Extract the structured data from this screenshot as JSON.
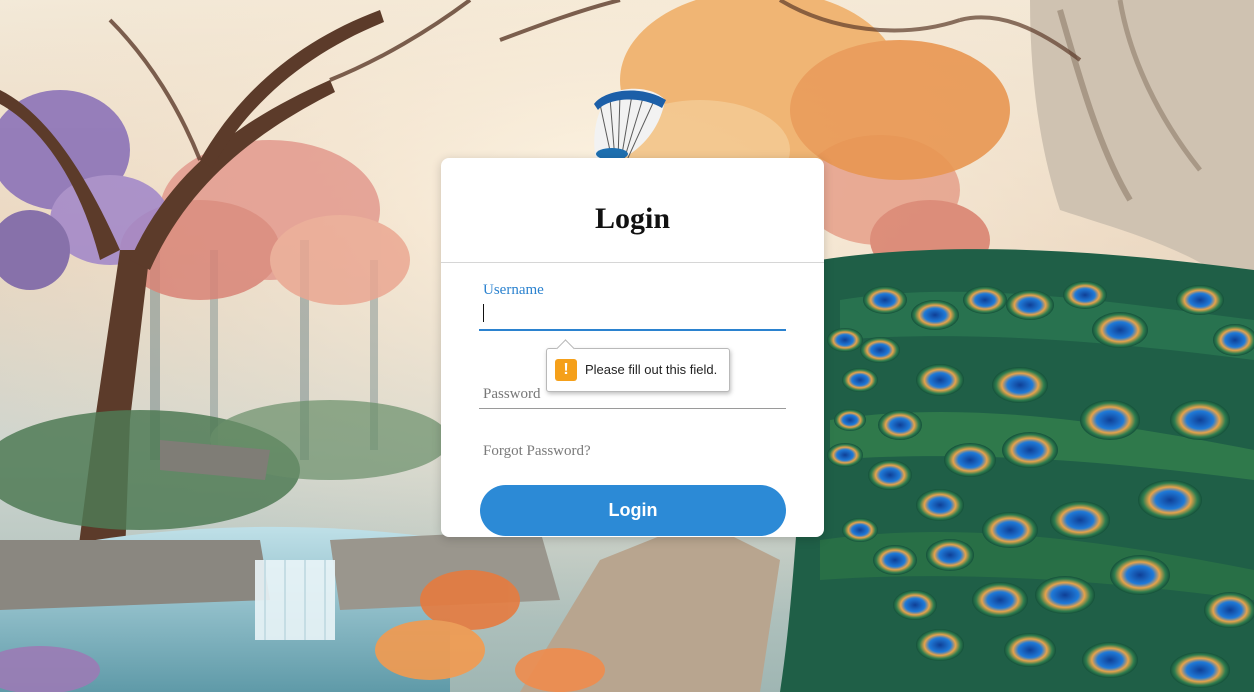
{
  "login_card": {
    "title": "Login",
    "username": {
      "label": "Username",
      "value": ""
    },
    "password": {
      "label": "Password",
      "value": ""
    },
    "forgot_link": "Forgot Password?",
    "submit_label": "Login"
  },
  "validation_tooltip": {
    "icon": "warning-icon",
    "icon_glyph": "!",
    "message": "Please fill out this field."
  },
  "background": {
    "description_icons": [
      "peacock",
      "trees",
      "waterfall"
    ],
    "colors": {
      "accent": "#2c8ad6",
      "focus_label": "#2b82cf",
      "warning": "#f5a01a"
    }
  }
}
